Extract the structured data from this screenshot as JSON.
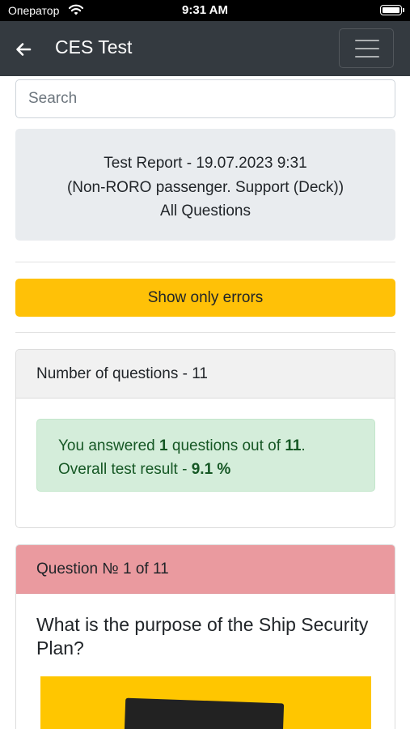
{
  "status_bar": {
    "carrier": "Оператор",
    "time": "9:31 AM"
  },
  "navbar": {
    "title": "CES Test"
  },
  "search": {
    "placeholder": "Search"
  },
  "report": {
    "line1": "Test Report - 19.07.2023 9:31",
    "line2": "(Non-RORO passenger. Support (Deck))",
    "line3": "All Questions"
  },
  "errors_button": "Show only errors",
  "summary": {
    "header": "Number of questions - 11",
    "answered_prefix": "You answered ",
    "answered_count": "1",
    "answered_middle": " questions out of ",
    "total": "11",
    "answered_suffix": ".",
    "result_prefix": "Overall test result - ",
    "result_value": "9.1 %"
  },
  "question": {
    "header": "Question № 1 of 11",
    "text": "What is the purpose of the Ship Security Plan?"
  },
  "colors": {
    "navbar": "#343a40",
    "warning": "#ffc107",
    "success_bg": "#d4edda",
    "success_text": "#155724",
    "danger_header": "#ea9a9f"
  }
}
